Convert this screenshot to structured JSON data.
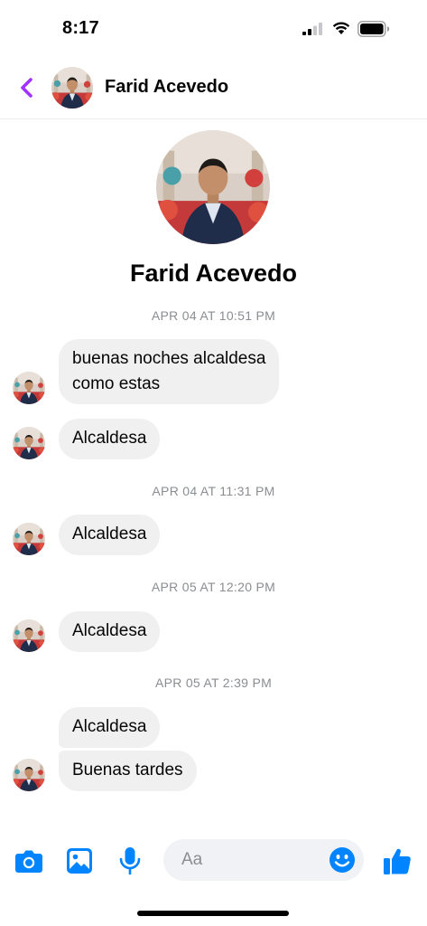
{
  "status_bar": {
    "time": "8:17"
  },
  "header": {
    "contact_name": "Farid Acevedo"
  },
  "profile": {
    "name": "Farid Acevedo"
  },
  "timestamps": [
    "APR 04 AT 10:51 PM",
    "APR 04 AT 11:31 PM",
    "APR 05 AT 12:20 PM",
    "APR 05 AT 2:39 PM"
  ],
  "messages": [
    {
      "line1": "buenas noches alcaldesa",
      "line2": "como estas"
    },
    {
      "text": "Alcaldesa"
    },
    {
      "text": "Alcaldesa"
    },
    {
      "text": "Alcaldesa"
    },
    {
      "text": "Alcaldesa"
    },
    {
      "text": "Buenas tardes"
    }
  ],
  "composer": {
    "placeholder": "Aa"
  },
  "colors": {
    "accent": "#0084ff",
    "back_arrow": "#a033ff",
    "bubble": "#f0f0f0",
    "timestamp": "#8a8d91"
  },
  "icons": [
    "back-arrow-icon",
    "camera-icon",
    "image-icon",
    "microphone-icon",
    "emoji-icon",
    "thumbs-up-icon"
  ]
}
